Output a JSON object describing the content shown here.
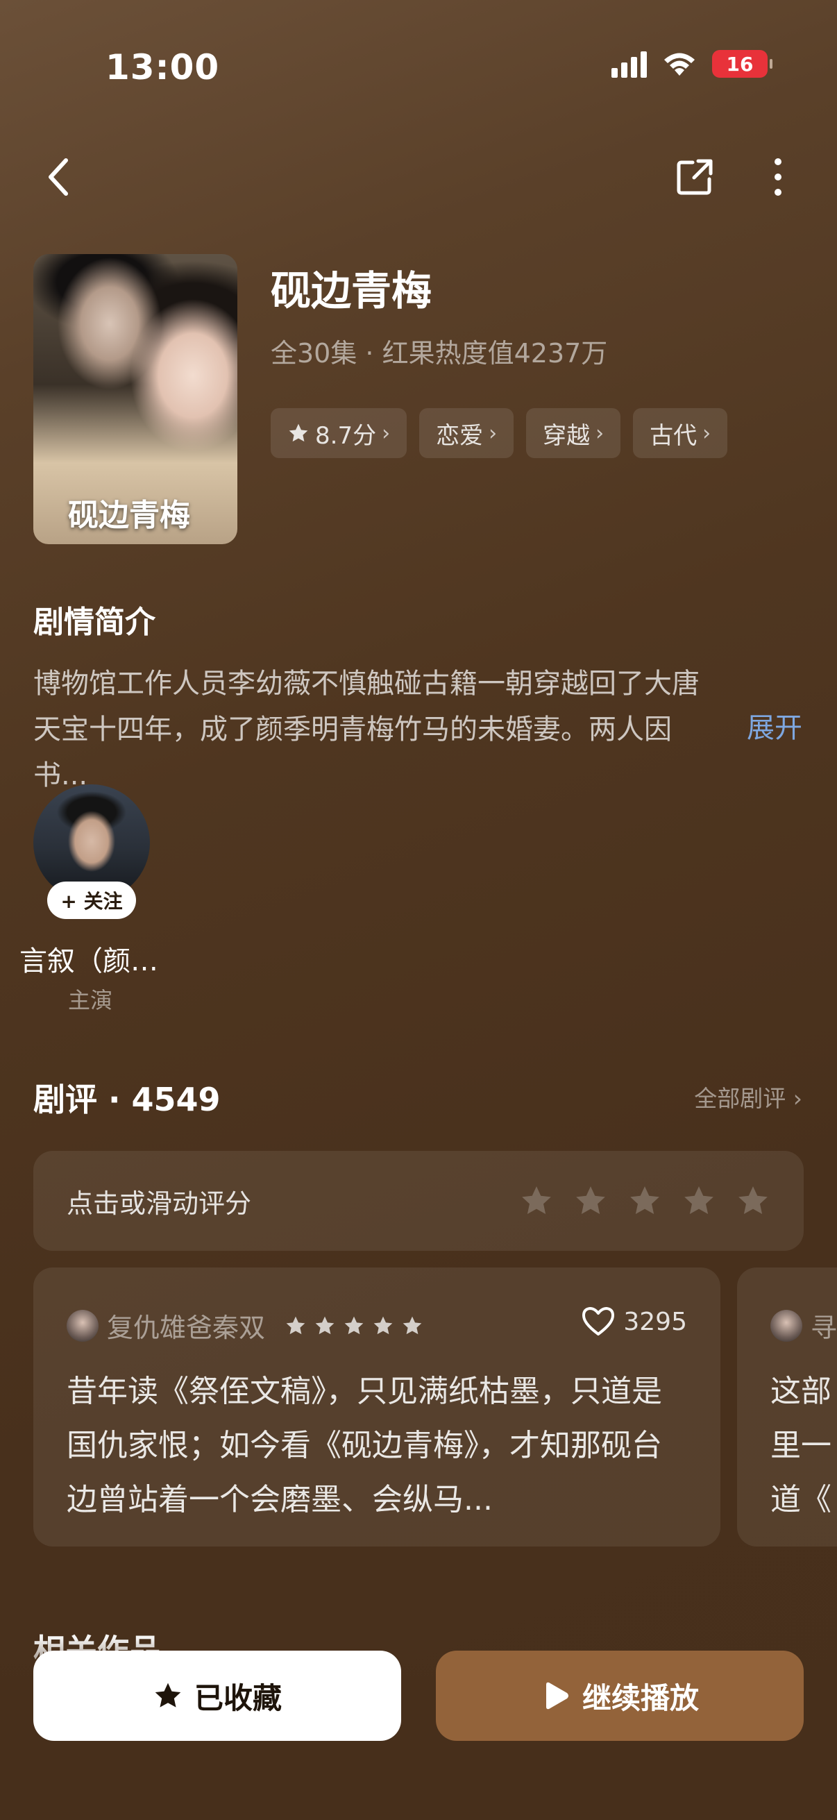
{
  "status": {
    "time": "13:00",
    "battery": "16"
  },
  "drama": {
    "title": "砚边青梅",
    "poster_title": "砚边青梅",
    "meta": "全30集 · 红果热度值4237万",
    "tags": [
      {
        "label": "8.7分",
        "icon": "star-icon"
      },
      {
        "label": "恋爱"
      },
      {
        "label": "穿越"
      },
      {
        "label": "古代"
      }
    ]
  },
  "synopsis": {
    "title": "剧情简介",
    "text": "博物馆工作人员李幼薇不慎触碰古籍一朝穿越回了大唐天宝十四年，成了颜季明青梅竹马的未婚妻。两人因书...",
    "expand": "展开"
  },
  "cast": [
    {
      "name": "言叙（颜…",
      "role": "主演",
      "follow": "+ 关注"
    }
  ],
  "reviews": {
    "title": "剧评 · 4549",
    "all_label": "全部剧评",
    "rate_prompt": "点击或滑动评分",
    "items": [
      {
        "user": "复仇雄爸秦双",
        "stars": 5,
        "likes": "3295",
        "text": "昔年读《祭侄文稿》，只见满纸枯墨，只道是国仇家恨；如今看《砚边青梅》，才知那砚台边曾站着一个会磨墨、会纵马..."
      },
      {
        "user": "寻",
        "text": "这部里一道《"
      }
    ]
  },
  "related_title": "相关作品",
  "actions": {
    "favorite": "已收藏",
    "play": "继续播放"
  },
  "colors": {
    "accent": "#93633a",
    "link": "#7ea7e0",
    "background": "#4f3620"
  }
}
